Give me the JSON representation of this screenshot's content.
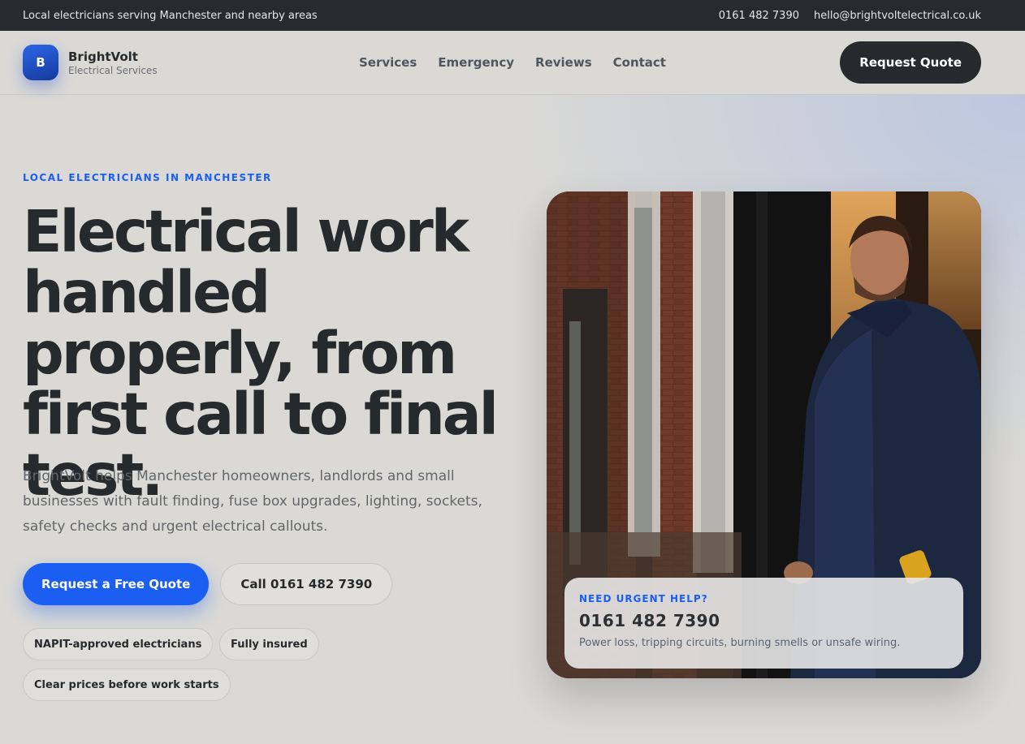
{
  "topbar": {
    "tagline": "Local electricians serving Manchester and nearby areas",
    "phone": "0161 482 7390",
    "email": "hello@brightvoltelectrical.co.uk"
  },
  "brand": {
    "logo_letter": "B",
    "name": "BrightVolt",
    "subtitle": "Electrical Services"
  },
  "nav": {
    "items": [
      "Services",
      "Emergency",
      "Reviews",
      "Contact"
    ],
    "quote_button": "Request Quote"
  },
  "hero": {
    "eyebrow": "LOCAL ELECTRICIANS IN MANCHESTER",
    "headline": "Electrical work handled properly, from first call to final test.",
    "lede": "BrightVolt helps Manchester homeowners, landlords and small businesses with fault finding, fuse box upgrades, lighting, sockets, safety checks and urgent electrical callouts.",
    "primary_cta": "Request a Free Quote",
    "secondary_cta": "Call 0161 482 7390",
    "badges": [
      "NAPIT-approved electricians",
      "Fully insured",
      "Clear prices before work starts"
    ]
  },
  "urgent_card": {
    "label": "NEED URGENT HELP?",
    "phone": "0161 482 7390",
    "text": "Power loss, tripping circuits, burning smells or unsafe wiring."
  },
  "colors": {
    "accent": "#1a5ef2",
    "dark": "#272a2c",
    "background": "#dad9d6"
  }
}
